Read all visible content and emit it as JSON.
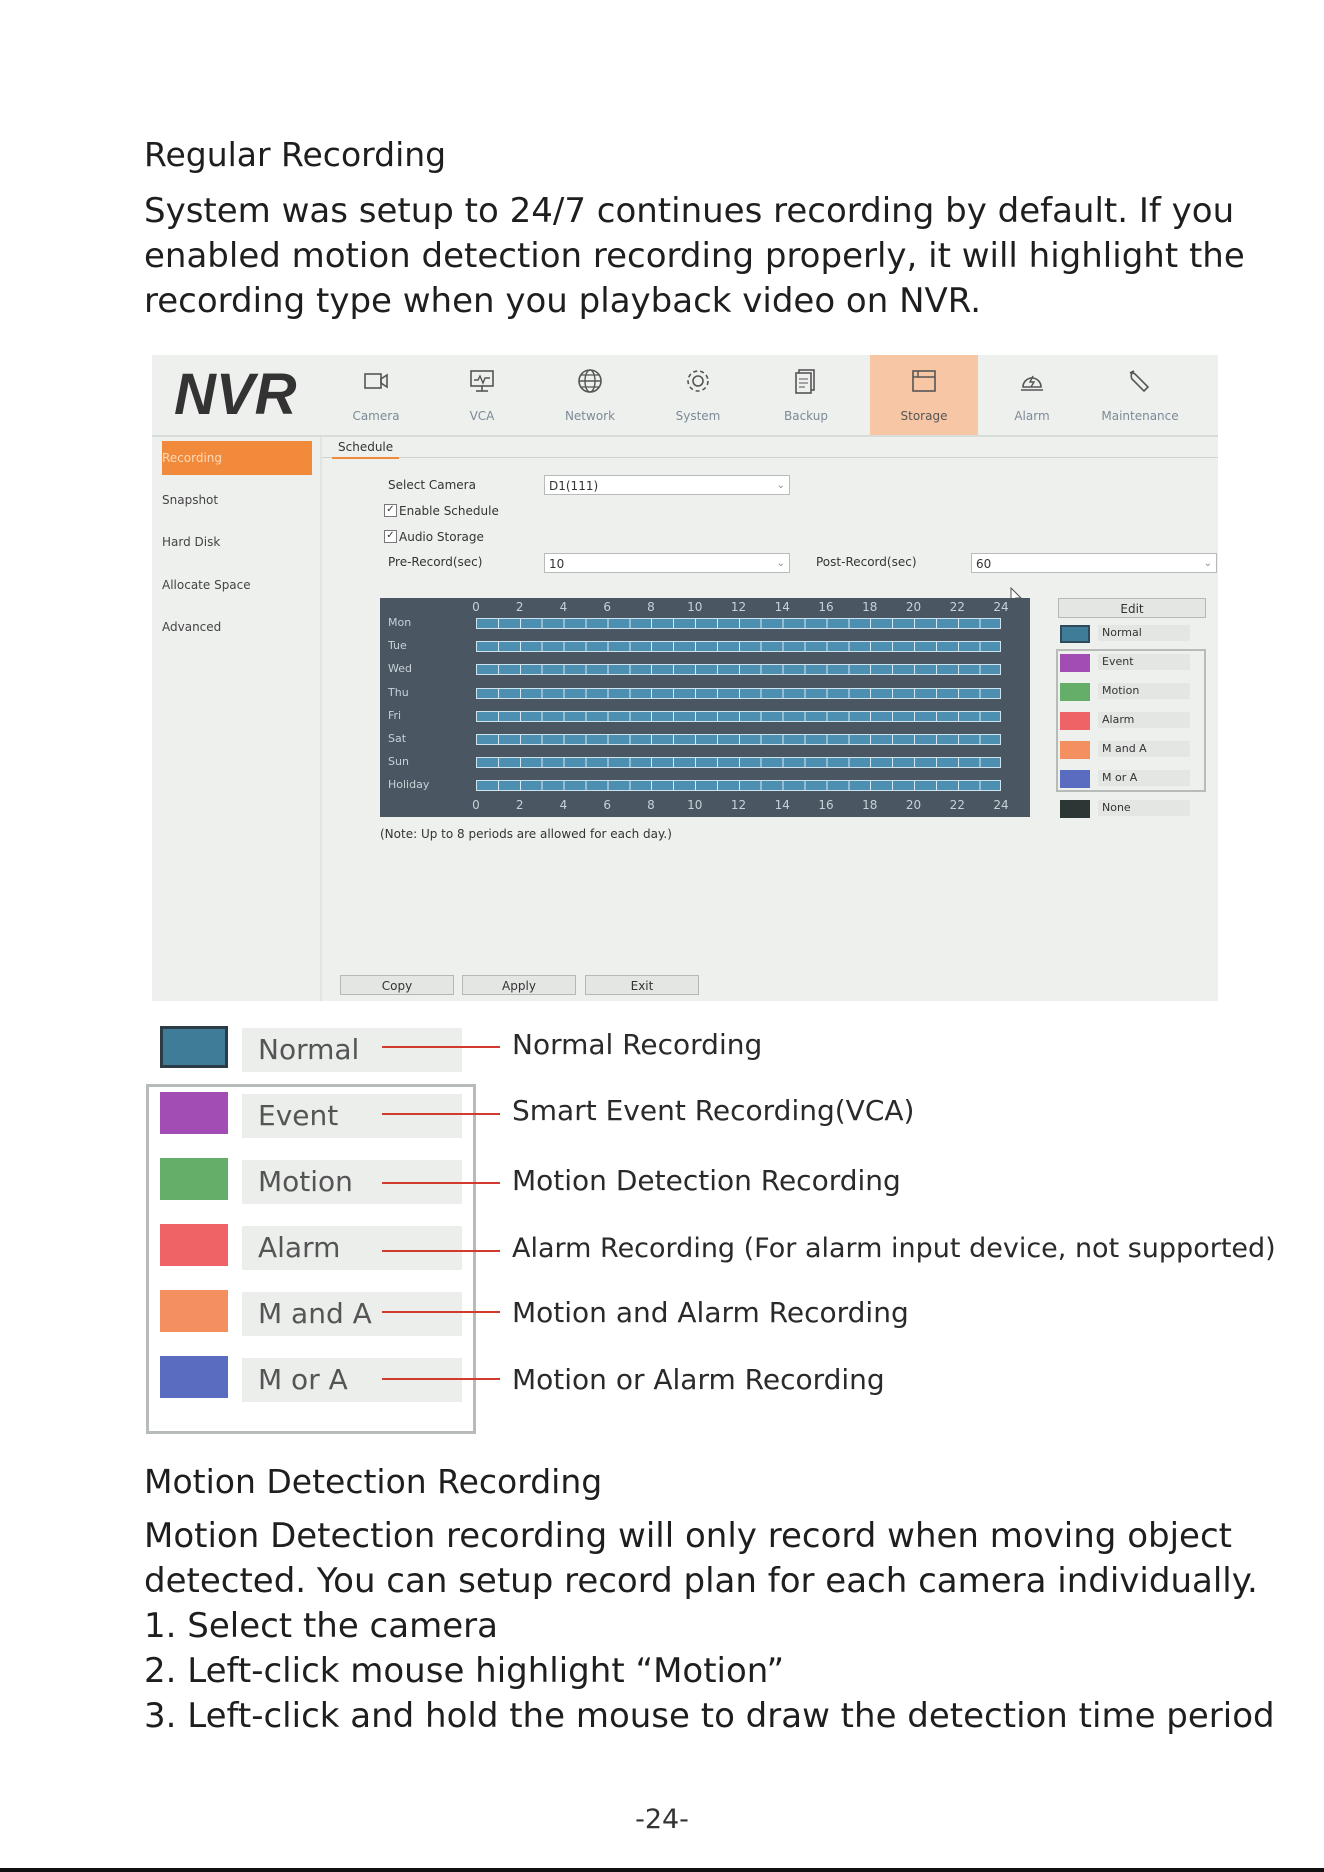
{
  "section1": {
    "heading": "Regular Recording",
    "lines": [
      "System was setup to 24/7 continues recording by default. If you",
      "enabled motion detection recording properly, it will highlight the",
      "recording type when you playback video on NVR."
    ]
  },
  "nvr": {
    "logo": "NVR",
    "nav": [
      {
        "label": "Camera",
        "icon": "camera-icon"
      },
      {
        "label": "VCA",
        "icon": "vca-monitor-icon"
      },
      {
        "label": "Network",
        "icon": "globe-icon"
      },
      {
        "label": "System",
        "icon": "gear-icon"
      },
      {
        "label": "Backup",
        "icon": "backup-icon"
      },
      {
        "label": "Storage",
        "icon": "storage-icon",
        "active": true
      },
      {
        "label": "Alarm",
        "icon": "alarm-icon"
      },
      {
        "label": "Maintenance",
        "icon": "wrench-icon"
      }
    ],
    "sidebar": [
      "Recording",
      "Snapshot",
      "Hard Disk",
      "Allocate Space",
      "Advanced"
    ],
    "tab": "Schedule",
    "form": {
      "select_camera_label": "Select Camera",
      "select_camera_value": "D1(111)",
      "enable_schedule": "Enable Schedule",
      "enable_schedule_checked": true,
      "audio_storage": "Audio Storage",
      "audio_storage_checked": true,
      "pre_record_label": "Pre-Record(sec)",
      "pre_record_value": "10",
      "post_record_label": "Post-Record(sec)",
      "post_record_value": "60"
    },
    "schedule": {
      "hours": [
        "0",
        "2",
        "4",
        "6",
        "8",
        "10",
        "12",
        "14",
        "16",
        "18",
        "20",
        "22",
        "24"
      ],
      "days": [
        "Mon",
        "Tue",
        "Wed",
        "Thu",
        "Fri",
        "Sat",
        "Sun",
        "Holiday"
      ],
      "note": "(Note: Up to 8 periods are allowed for each day.)"
    },
    "edit_label": "Edit",
    "legend": [
      {
        "name": "Normal",
        "color": "#3f7c98"
      },
      {
        "name": "Event",
        "color": "#a24db3"
      },
      {
        "name": "Motion",
        "color": "#64ae6a"
      },
      {
        "name": "Alarm",
        "color": "#ef6366"
      },
      {
        "name": "M and A",
        "color": "#f49060"
      },
      {
        "name": "M or A",
        "color": "#5a6cc0"
      },
      {
        "name": "None",
        "color": "#2c3634"
      }
    ],
    "buttons": {
      "copy": "Copy",
      "apply": "Apply",
      "exit": "Exit"
    }
  },
  "zoom_legend": [
    {
      "name": "Normal",
      "color": "#3f7c98",
      "desc": "Normal Recording"
    },
    {
      "name": "Event",
      "color": "#a24db3",
      "desc": "Smart Event Recording(VCA)"
    },
    {
      "name": "Motion",
      "color": "#64ae6a",
      "desc": "Motion Detection Recording"
    },
    {
      "name": "Alarm",
      "color": "#ef6366",
      "desc": "Alarm Recording (For alarm input device, not supported)"
    },
    {
      "name": "M and A",
      "color": "#f49060",
      "desc": "Motion and Alarm Recording"
    },
    {
      "name": "M or A",
      "color": "#5a6cc0",
      "desc": "Motion or Alarm Recording"
    }
  ],
  "section2": {
    "heading": "Motion Detection Recording",
    "lines": [
      "Motion Detection recording will only record when moving object",
      "detected. You can setup record plan for each camera individually.",
      "1. Select the camera",
      "2. Left-click mouse highlight “Motion”",
      "3. Left-click and hold the mouse to draw the detection time period"
    ]
  },
  "page_number": "-24-"
}
